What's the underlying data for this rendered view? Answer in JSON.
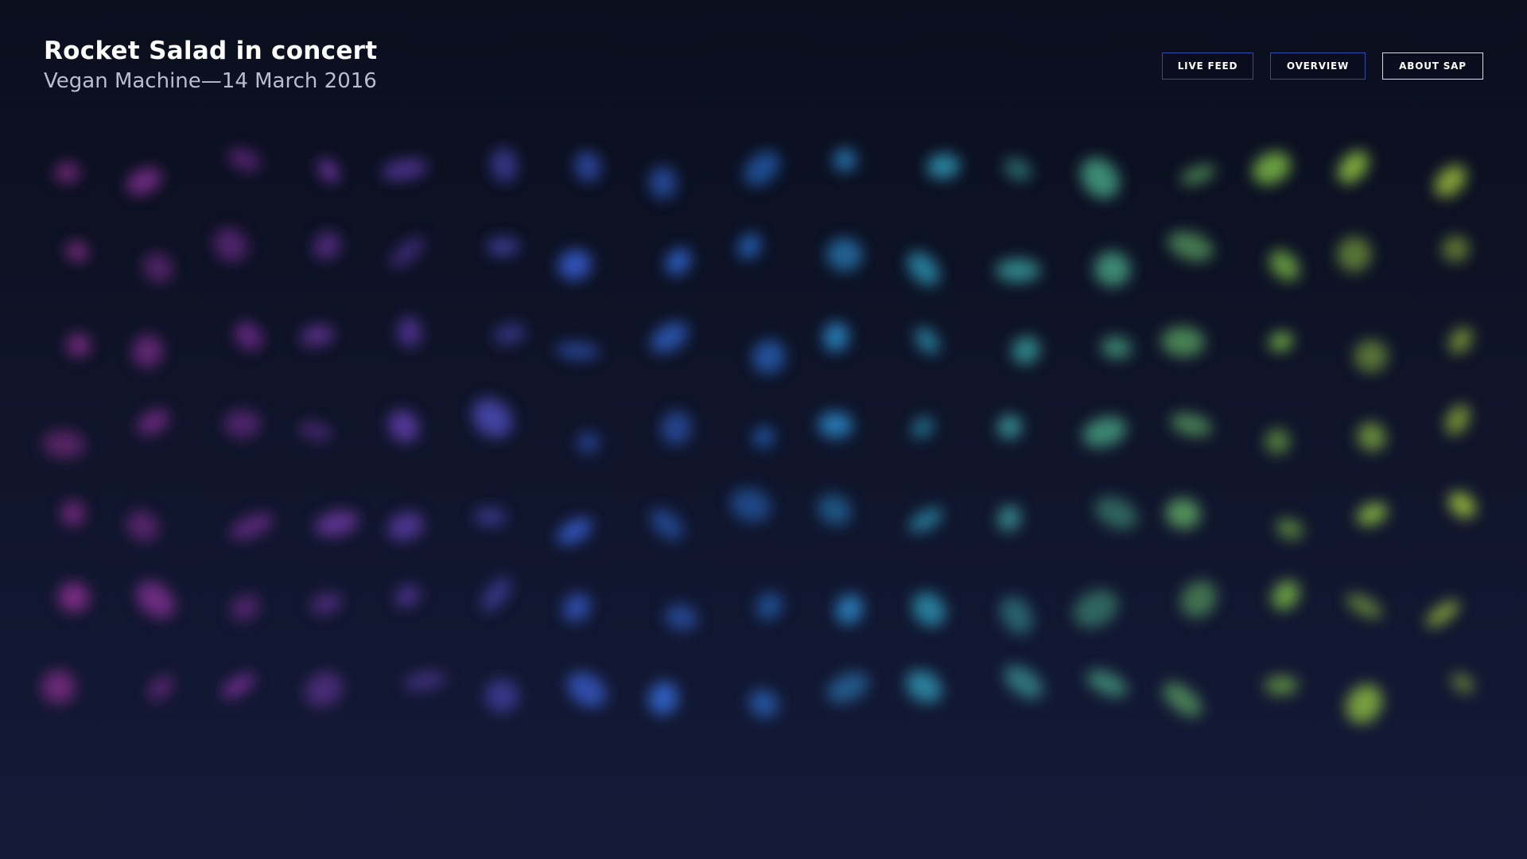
{
  "header": {
    "title": "Rocket Salad in concert",
    "subtitle": "Vegan Machine—14 March 2016"
  },
  "nav": {
    "live_feed": "LIVE FEED",
    "overview": "OVERVIEW",
    "about": "ABOUT SAP"
  },
  "colors": {
    "background_top": "#0a0e1d",
    "background_bottom": "#141a38",
    "accent_border": "#2f4ca8",
    "palette_start": "#8a2f8f",
    "palette_mid": "#2f6fd0",
    "palette_end": "#9bbf40"
  }
}
